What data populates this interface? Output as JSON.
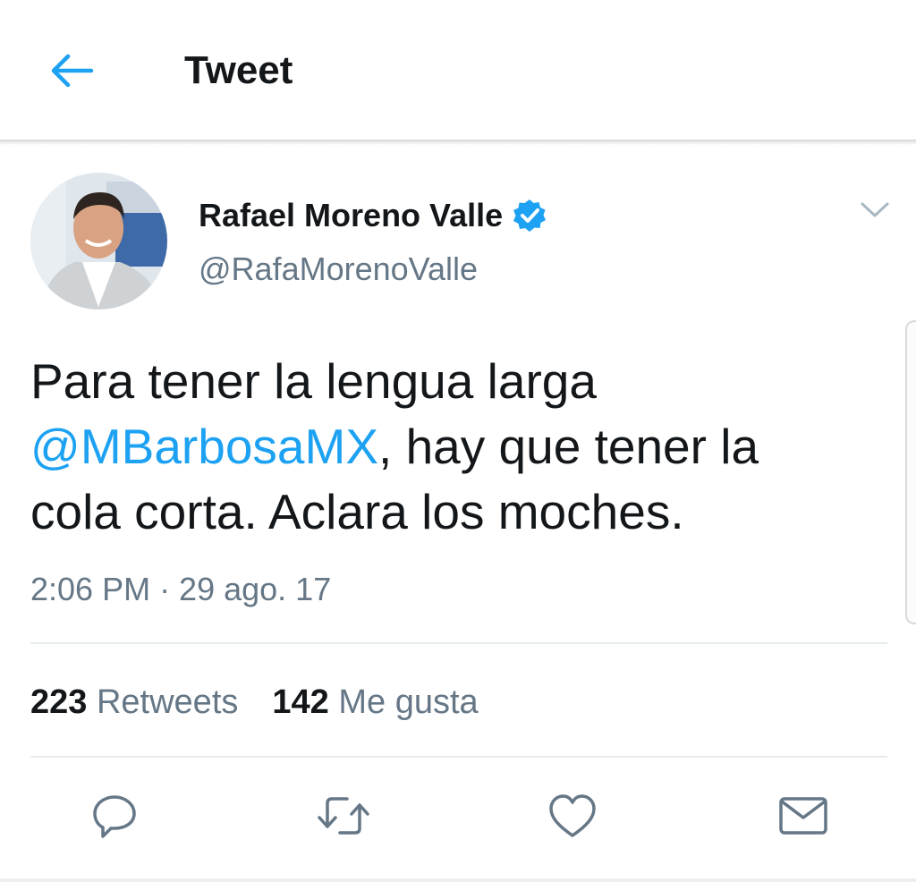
{
  "header": {
    "title": "Tweet",
    "back_icon": "arrow-left-icon",
    "accent_color": "#1da1f2"
  },
  "tweet": {
    "author": {
      "name": "Rafael Moreno Valle",
      "handle": "@RafaMorenoValle",
      "verified": true
    },
    "text": {
      "line1": "Para tener la lengua larga",
      "mention": "@MBarbosaMX",
      "after_mention": ", hay que tener la",
      "line3": "cola corta. Aclara los moches."
    },
    "timestamp": "2:06 PM · 29 ago. 17",
    "stats": {
      "retweets_count": "223",
      "retweets_label": "Retweets",
      "likes_count": "142",
      "likes_label": "Me gusta"
    }
  },
  "actions": [
    {
      "icon": "reply-icon"
    },
    {
      "icon": "retweet-icon"
    },
    {
      "icon": "heart-icon"
    },
    {
      "icon": "envelope-icon"
    }
  ],
  "colors": {
    "text_primary": "#14171a",
    "text_secondary": "#657786",
    "link": "#1da1f2",
    "divider": "#e6ecf0"
  }
}
